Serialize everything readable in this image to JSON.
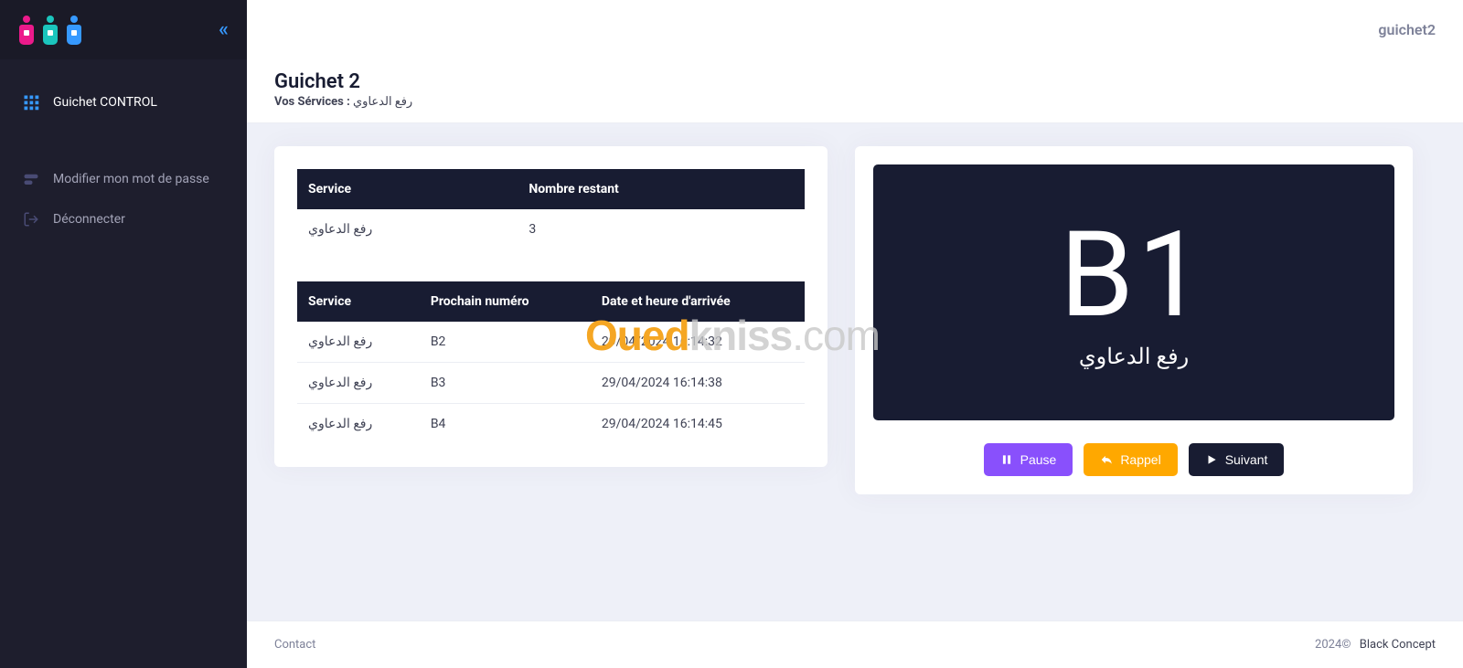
{
  "header": {
    "user_label": "guichet2"
  },
  "sidebar": {
    "collapse_glyph": "«",
    "items": [
      {
        "id": "guichet-control",
        "label": "Guichet CONTROL",
        "icon": "grid-icon",
        "active": true
      },
      {
        "id": "modifier-mdp",
        "label": "Modifier mon mot de passe",
        "icon": "toggle-icon",
        "active": false
      },
      {
        "id": "deconnecter",
        "label": "Déconnecter",
        "icon": "logout-icon",
        "active": false
      }
    ]
  },
  "subheader": {
    "title": "Guichet 2",
    "services_label": "Vos Sérvices :",
    "services_value": "رفع الدعاوي"
  },
  "summary_table": {
    "headers": {
      "service": "Service",
      "remaining": "Nombre restant"
    },
    "rows": [
      {
        "service": "رفع الدعاوي",
        "remaining": "3"
      }
    ]
  },
  "queue_table": {
    "headers": {
      "service": "Service",
      "next": "Prochain numéro",
      "arrival": "Date et heure d'arrivée"
    },
    "rows": [
      {
        "service": "رفع الدعاوي",
        "next": "B2",
        "arrival": "29/04/2024 16:14:32"
      },
      {
        "service": "رفع الدعاوي",
        "next": "B3",
        "arrival": "29/04/2024 16:14:38"
      },
      {
        "service": "رفع الدعاوي",
        "next": "B4",
        "arrival": "29/04/2024 16:14:45"
      }
    ]
  },
  "display": {
    "current_ticket": "B1",
    "current_service": "رفع الدعاوي"
  },
  "actions": {
    "pause": "Pause",
    "rappel": "Rappel",
    "suivant": "Suivant"
  },
  "footer": {
    "contact": "Contact",
    "year": "2024©",
    "brand": "Black Concept"
  },
  "watermark": {
    "part1": "Oued",
    "part2": "kniss",
    "part3": ".com"
  }
}
